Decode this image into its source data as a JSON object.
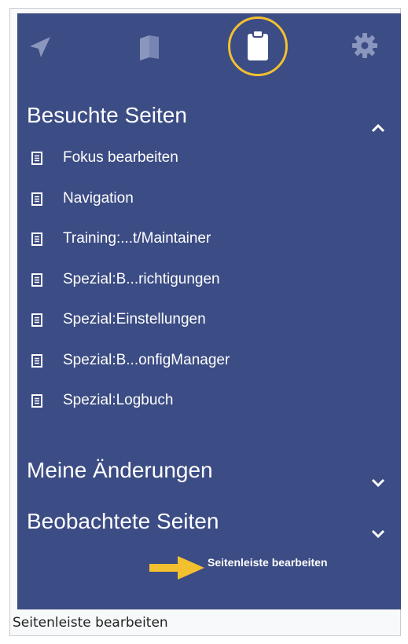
{
  "tabs": [
    {
      "icon": "navigation-arrow-icon",
      "state": "inactive"
    },
    {
      "icon": "book-icon",
      "state": "inactive"
    },
    {
      "icon": "clipboard-icon",
      "state": "active"
    },
    {
      "icon": "gear-icon",
      "state": "inactive"
    }
  ],
  "sections": {
    "visited": {
      "title": "Besuchte Seiten",
      "expanded": true,
      "items": [
        "Fokus bearbeiten",
        "Navigation",
        "Training:...t/Maintainer",
        "Spezial:B...richtigungen",
        "Spezial:Einstellungen",
        "Spezial:B...onfigManager",
        "Spezial:Logbuch"
      ]
    },
    "my_changes": {
      "title": "Meine Änderungen",
      "expanded": false
    },
    "watched": {
      "title": "Beobachtete Seiten",
      "expanded": false
    }
  },
  "annotation": {
    "label": "Seitenleiste bearbeiten"
  },
  "caption": "Seitenleiste bearbeiten",
  "colors": {
    "panel": "#3c4c84",
    "highlight": "#f3c02f",
    "icon_inactive": "#8a96bd",
    "text": "#ffffff"
  }
}
